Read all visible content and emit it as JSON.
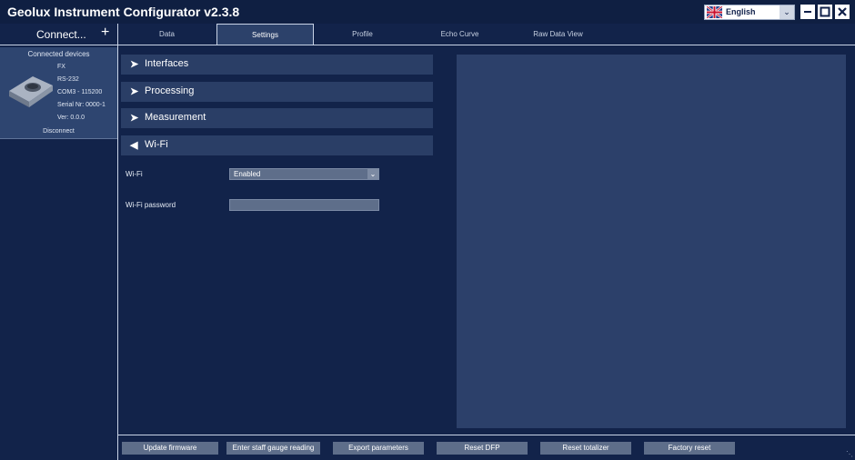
{
  "app": {
    "title": "Geolux Instrument Configurator v2.3.8"
  },
  "language": {
    "selected": "English"
  },
  "sidebar": {
    "connect_label": "Connect...",
    "connected_heading": "Connected devices",
    "device": {
      "lines": [
        "FX",
        "RS-232",
        "COM3 - 115200",
        "Serial Nr: 0000-1",
        "Ver: 0.0.0"
      ],
      "disconnect_label": "Disconnect"
    }
  },
  "tabs": [
    {
      "label": "Data",
      "active": false
    },
    {
      "label": "Settings",
      "active": true
    },
    {
      "label": "Profile",
      "active": false
    },
    {
      "label": "Echo Curve",
      "active": false
    },
    {
      "label": "Raw Data View",
      "active": false
    }
  ],
  "sections": [
    {
      "label": "Interfaces",
      "expanded": false
    },
    {
      "label": "Processing",
      "expanded": false
    },
    {
      "label": "Measurement",
      "expanded": false
    },
    {
      "label": "Wi-Fi",
      "expanded": true
    }
  ],
  "wifi": {
    "wifi_label": "Wi-Fi",
    "wifi_value": "Enabled",
    "password_label": "Wi-Fi password",
    "password_value": ""
  },
  "bottom_buttons": [
    "Update firmware",
    "Enter staff gauge reading",
    "Export parameters",
    "Reset DFP",
    "Reset totalizer",
    "Factory reset"
  ],
  "colors": {
    "background": "#12234a",
    "panel": "#2c406a",
    "section": "#2a3e66",
    "button": "#5e6e8a"
  }
}
